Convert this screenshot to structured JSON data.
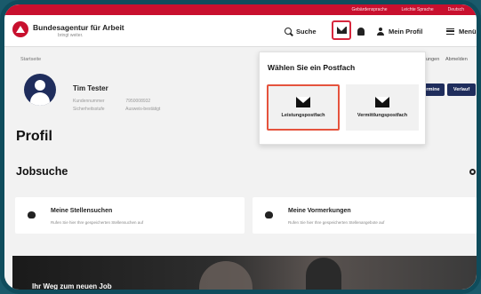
{
  "topbar": {
    "items": [
      "Gebärdensprache",
      "Leichte Sprache",
      "Deutsch"
    ]
  },
  "header": {
    "brand_name": "Bundesagentur für Arbeit",
    "brand_sub": "bringt weiter.",
    "search_label": "Suche",
    "profile_label": "Mein Profil",
    "menu_label": "Menü"
  },
  "breadcrumb": "Startseite",
  "top_links": {
    "prev": "ungen",
    "logout": "Abmelden"
  },
  "user": {
    "name": "Tim Tester",
    "customer_number_label": "Kundennummer",
    "customer_number": "7950008932",
    "security_level_label": "Sicherheitsstufe",
    "security_level": "Ausweis-bestätigt"
  },
  "pills": {
    "termine": "ermine",
    "verlauf": "Verlauf"
  },
  "page_title": "Profil",
  "section_title": "Jobsuche",
  "cards": [
    {
      "title": "Meine Stellensuchen",
      "description": "Rufen Sie hier Ihre gespeicherten Stellensuchen auf"
    },
    {
      "title": "Meine Vormerkungen",
      "description": "Rufen Sie hier Ihre gespeicherten Stellenangebote auf"
    }
  ],
  "banner": {
    "text": "Ihr Weg zum neuen Job"
  },
  "mailbox_dropdown": {
    "title": "Wählen Sie ein Postfach",
    "options": [
      {
        "label": "Leistungspostfach",
        "selected": true
      },
      {
        "label": "Vermittlungspostfach",
        "selected": false
      }
    ]
  },
  "colors": {
    "brand_red": "#c8102e",
    "navy": "#1f2d5c",
    "highlight": "#e5533d"
  }
}
